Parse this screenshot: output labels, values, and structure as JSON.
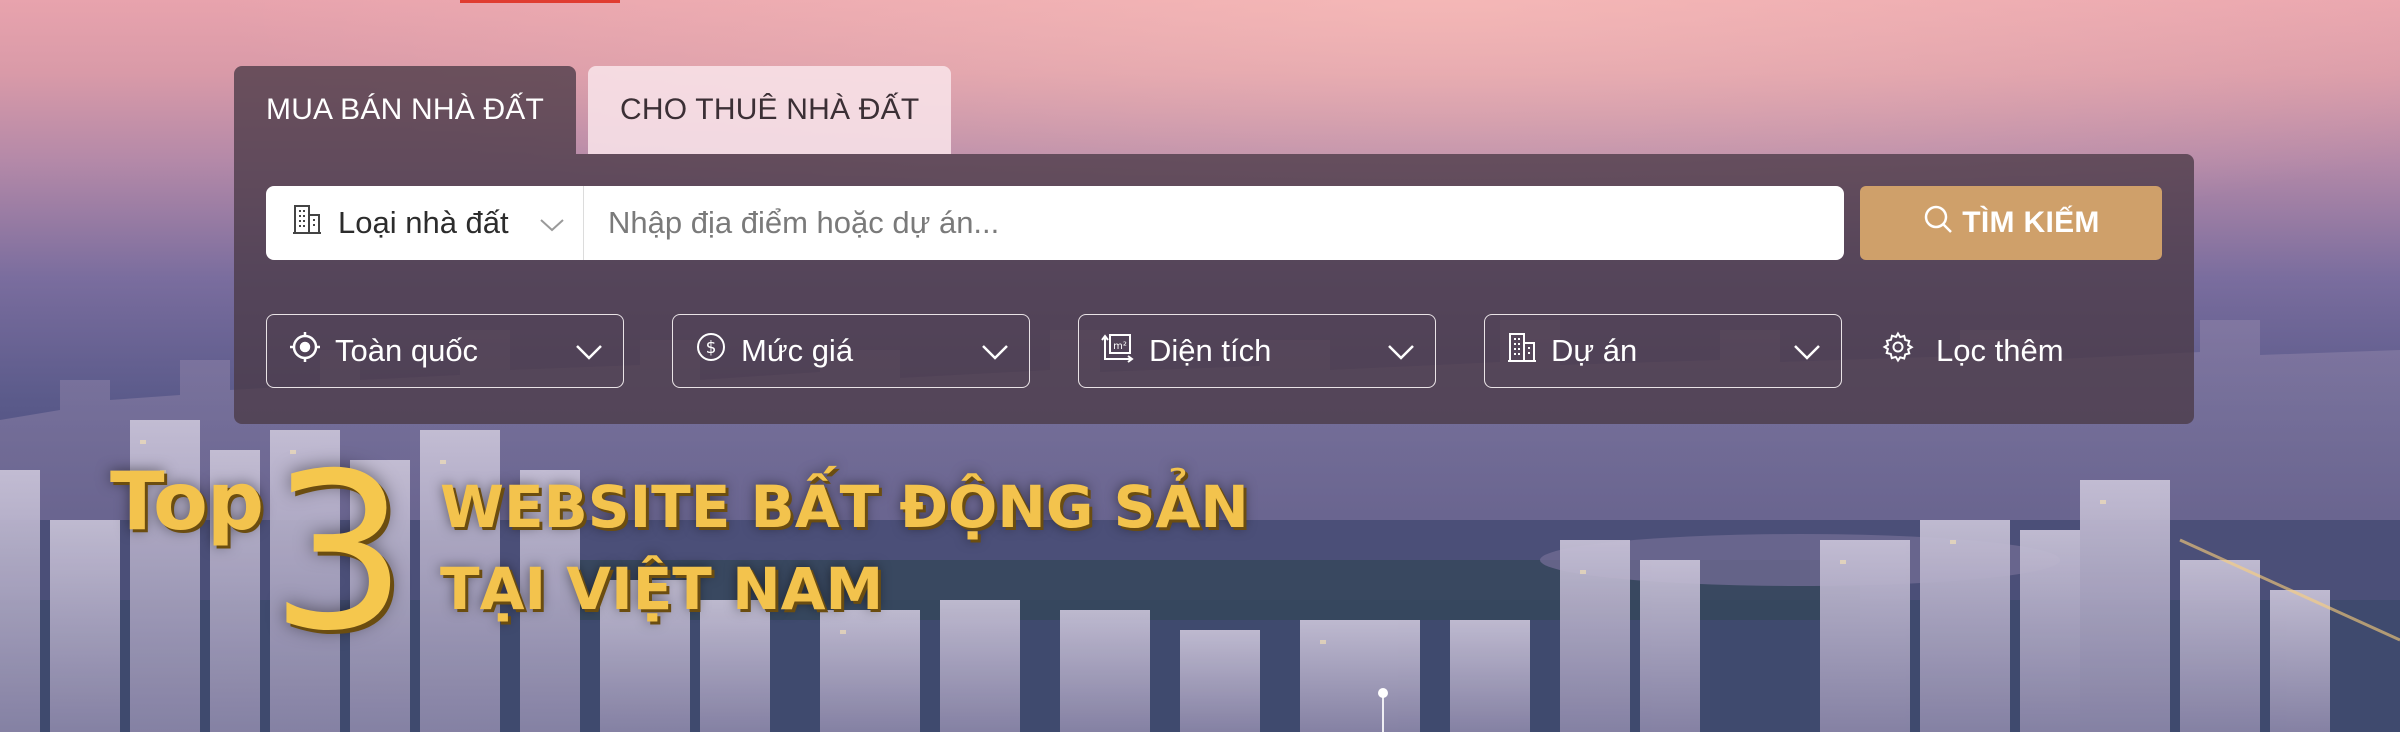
{
  "tabs": [
    {
      "label": "MUA BÁN NHÀ ĐẤT",
      "active": true
    },
    {
      "label": "CHO THUÊ NHÀ ĐẤT",
      "active": false
    }
  ],
  "search": {
    "type_label": "Loại nhà đất",
    "placeholder": "Nhập địa điểm hoặc dự án...",
    "button_label": "TÌM KIẾM"
  },
  "filters": {
    "location": "Toàn quốc",
    "price": "Mức giá",
    "area": "Diện tích",
    "project": "Dự án",
    "more": "Lọc thêm"
  },
  "headline": {
    "top": "Top",
    "number": "3",
    "line1": "WEBSITE BẤT ĐỘNG SẢN",
    "line2": "TẠI VIỆT NAM"
  },
  "colors": {
    "accent": "#cfa06a",
    "panel": "#4a3a46",
    "headline_gold": "#f3c34d",
    "top_bar": "#e03c31"
  }
}
